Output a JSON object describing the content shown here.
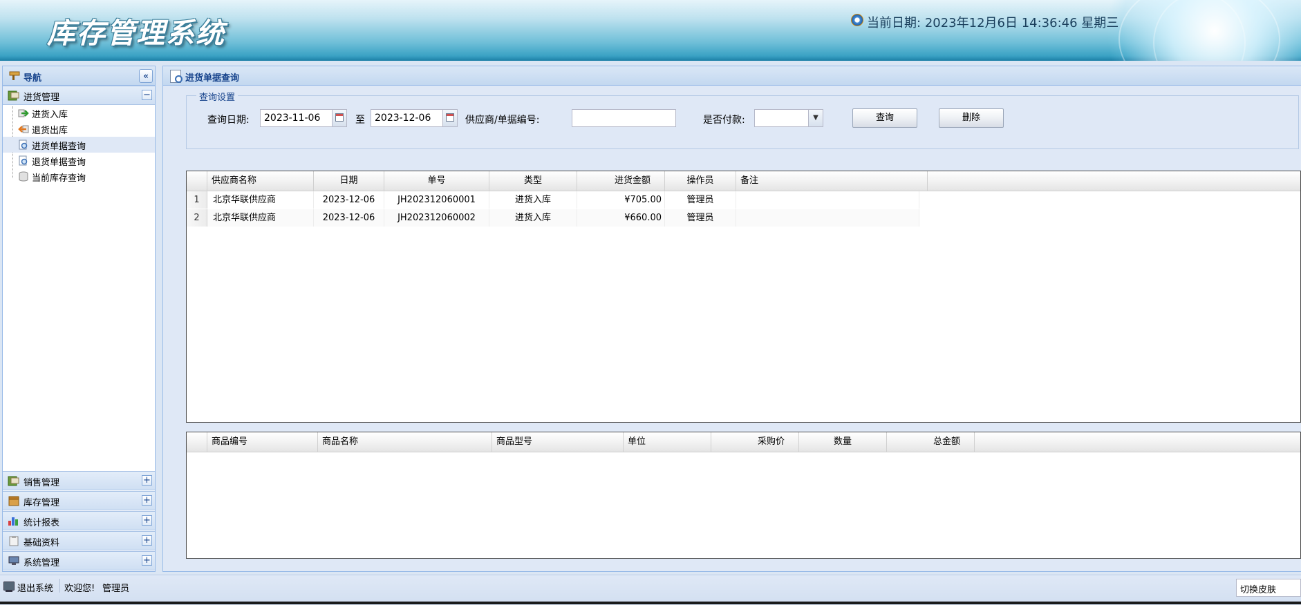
{
  "header": {
    "app_title": "库存管理系统",
    "date_label": "当前日期:",
    "date_value": "2023年12月6日 14:36:46 星期三"
  },
  "nav": {
    "title": "导航",
    "collapse_symbol": "«",
    "sections": [
      {
        "label": "进货管理",
        "toggle": "−",
        "expanded": true
      },
      {
        "label": "销售管理",
        "toggle": "+"
      },
      {
        "label": "库存管理",
        "toggle": "+"
      },
      {
        "label": "统计报表",
        "toggle": "+"
      },
      {
        "label": "基础资料",
        "toggle": "+"
      },
      {
        "label": "系统管理",
        "toggle": "+"
      }
    ],
    "items": [
      {
        "label": "进货入库"
      },
      {
        "label": "退货出库"
      },
      {
        "label": "进货单据查询",
        "selected": true
      },
      {
        "label": "退货单据查询"
      },
      {
        "label": "当前库存查询"
      }
    ]
  },
  "main": {
    "title": "进货单据查询",
    "query": {
      "legend": "查询设置",
      "date_label": "查询日期:",
      "start_date": "2023-11-06",
      "to_label": "至",
      "end_date": "2023-12-06",
      "supplier_label": "供应商/单据编号:",
      "supplier_value": "",
      "paid_label": "是否付款:",
      "paid_value": "",
      "query_button": "查询",
      "delete_button": "删除"
    },
    "orders_grid": {
      "columns": [
        "供应商名称",
        "日期",
        "单号",
        "类型",
        "进货金额",
        "操作员",
        "备注"
      ],
      "rows": [
        {
          "no": "1",
          "supplier": "北京华联供应商",
          "date": "2023-12-06",
          "number": "JH202312060001",
          "type": "进货入库",
          "amount": "¥705.00",
          "operator": "管理员",
          "remark": ""
        },
        {
          "no": "2",
          "supplier": "北京华联供应商",
          "date": "2023-12-06",
          "number": "JH202312060002",
          "type": "进货入库",
          "amount": "¥660.00",
          "operator": "管理员",
          "remark": ""
        }
      ]
    },
    "detail_grid": {
      "columns": [
        "商品编号",
        "商品名称",
        "商品型号",
        "单位",
        "采购价",
        "数量",
        "总金额"
      ]
    }
  },
  "footer": {
    "logout": "退出系统",
    "welcome": "欢迎您!",
    "user": "管理员",
    "skin_label": "切换皮肤"
  }
}
